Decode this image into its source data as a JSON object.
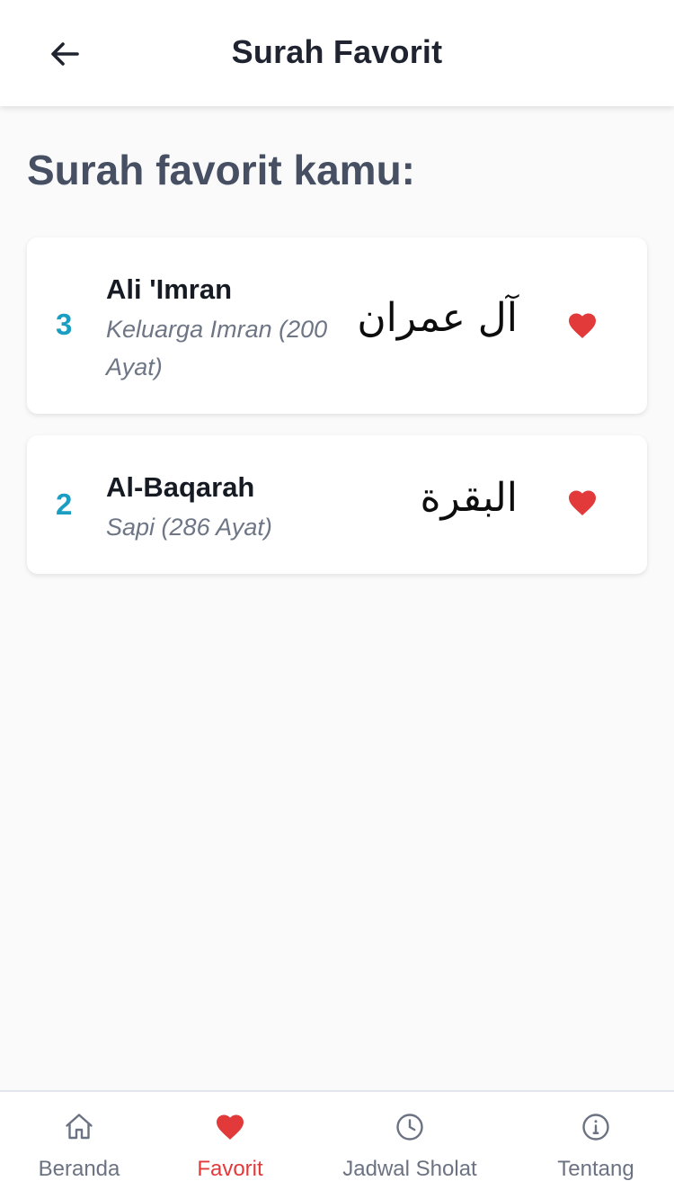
{
  "header": {
    "title": "Surah Favorit"
  },
  "section": {
    "title": "Surah favorit kamu:"
  },
  "favorites": [
    {
      "number": "3",
      "name": "Ali 'Imran",
      "subtitle": "Keluarga Imran (200 Ayat)",
      "arabic": "آل عمران"
    },
    {
      "number": "2",
      "name": "Al-Baqarah",
      "subtitle": "Sapi (286 Ayat)",
      "arabic": "البقرة"
    }
  ],
  "nav": {
    "items": [
      {
        "label": "Beranda",
        "icon": "home-icon"
      },
      {
        "label": "Favorit",
        "icon": "heart-icon"
      },
      {
        "label": "Jadwal Sholat",
        "icon": "clock-icon"
      },
      {
        "label": "Tentang",
        "icon": "info-icon"
      }
    ],
    "active_index": 1
  },
  "colors": {
    "accent_number": "#1a9ec2",
    "heart": "#e23a3a",
    "inactive_nav": "#6b7282"
  }
}
